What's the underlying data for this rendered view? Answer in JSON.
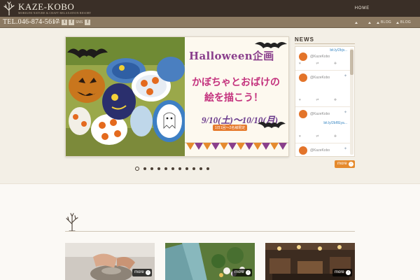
{
  "header": {
    "logo_text": "KAZE-KOBO",
    "logo_subtext": "MORIGINI NATURE & CRAFT RELAXATION RESORT",
    "nav_home": "HOME",
    "phone": "TEL.046-874-5617",
    "sns_label_1": "SNS",
    "sns_label_2": "SNS",
    "sns_icons": [
      "twitter-icon",
      "facebook-icon",
      "facebook-icon"
    ],
    "sub_nav": [
      {
        "label": "",
        "icon": "triangle-up-icon"
      },
      {
        "label": "",
        "icon": "triangle-up-icon"
      },
      {
        "label": "BLOG",
        "icon": "triangle-up-icon"
      },
      {
        "label": "BLOG",
        "icon": "triangle-up-icon"
      }
    ]
  },
  "slider": {
    "title": "Halloween企画",
    "headline_1": "かぼちゃとおばけの",
    "headline_2": "絵を描こう！",
    "date_text": "9/10(土)〜10/10(月)",
    "date_subtext": "1日1回〜2名様限定",
    "dot_count": 11,
    "active_dot": 0
  },
  "news": {
    "title": "NEWS",
    "tweets": [
      {
        "handle": "@KazeKobo",
        "link": "bit.ly/2bjv..."
      },
      {
        "handle": "@KazeKobo",
        "link": ""
      },
      {
        "handle": "@KazeKobo",
        "link": "bit.ly/2bREya..."
      },
      {
        "handle": "@KazeKobo",
        "link": ""
      }
    ],
    "more_label": "more"
  },
  "cards": [
    {
      "more_label": "more"
    },
    {
      "more_label": "more"
    },
    {
      "more_label": "more"
    }
  ],
  "colors": {
    "topbar": "#3a2f27",
    "subbar": "#8c7a62",
    "accent_orange": "#e58a2d",
    "background": "#f3efe6"
  }
}
